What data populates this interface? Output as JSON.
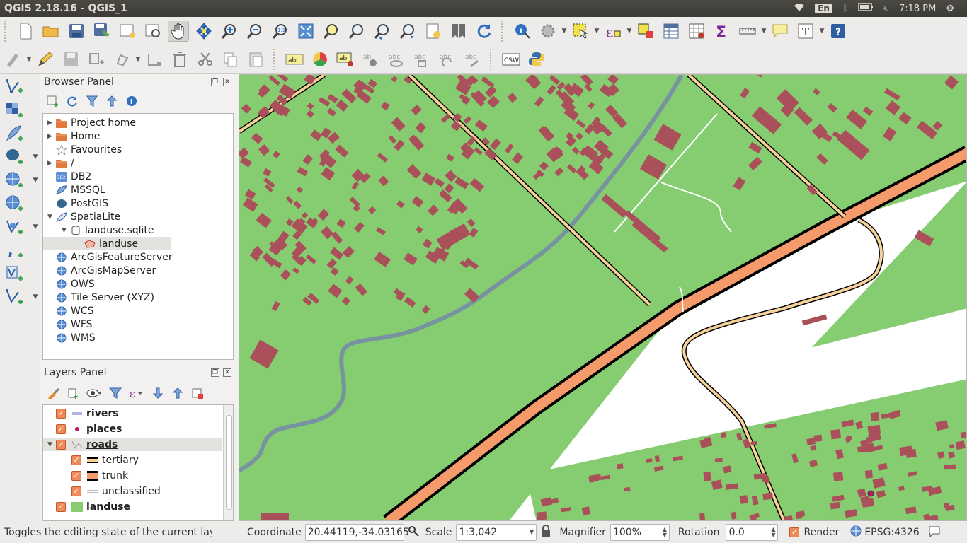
{
  "window": {
    "title": "QGIS 2.18.16 - QGIS_1"
  },
  "tray": {
    "lang": "En",
    "time": "7:18 PM"
  },
  "toolbar1": {
    "icons": [
      "new-project-icon",
      "open-project-icon",
      "save-project-icon",
      "save-as-icon",
      "new-print-composer-icon",
      "composer-manager-icon",
      "pan-icon",
      "pan-to-selection-icon",
      "zoom-in-icon",
      "zoom-out-icon",
      "zoom-native-icon",
      "zoom-full-icon",
      "zoom-to-selection-icon",
      "zoom-to-layer-icon",
      "zoom-last-icon",
      "zoom-next-icon",
      "new-bookmark-icon",
      "show-bookmarks-icon",
      "refresh-icon",
      "identify-icon",
      "run-feature-action-icon",
      "select-features-icon",
      "select-by-expression-icon",
      "deselect-icon",
      "attribute-table-icon",
      "field-calculator-icon",
      "statistics-icon",
      "measure-icon",
      "map-tips-icon",
      "text-annotation-icon",
      "help-icon"
    ]
  },
  "toolbar2": {
    "icons": [
      "current-edits-icon",
      "toggle-editing-icon",
      "save-edits-icon",
      "add-feature-icon",
      "move-feature-icon",
      "node-tool-icon",
      "delete-selected-icon",
      "cut-features-icon",
      "copy-features-icon",
      "paste-features-icon",
      "layer-labeling-icon",
      "diagram-options-icon",
      "pin-labels-icon",
      "show-hide-labels-icon",
      "move-label-icon",
      "rotate-label-icon",
      "change-label-icon",
      "csw-icon",
      "python-console-icon"
    ],
    "csw_label": "CSW",
    "abc_label": "abc"
  },
  "left_toolbar": {
    "icons": [
      "add-vector-layer-icon",
      "add-raster-layer-icon",
      "add-spatialite-layer-icon",
      "add-postgis-layer-icon",
      "add-wms-layer-icon",
      "add-wfs-layer-icon",
      "add-wcs-layer-icon",
      "add-delimited-text-icon",
      "add-virtual-layer-icon",
      "new-shapefile-icon"
    ]
  },
  "browser_panel": {
    "title": "Browser Panel",
    "items": [
      {
        "label": "Project home",
        "icon": "folder-icon",
        "arrow": "▶"
      },
      {
        "label": "Home",
        "icon": "folder-icon",
        "arrow": "▶"
      },
      {
        "label": "Favourites",
        "icon": "star-icon",
        "arrow": ""
      },
      {
        "label": "/",
        "icon": "folder-icon",
        "arrow": "▶"
      },
      {
        "label": "DB2",
        "icon": "db2-icon",
        "arrow": ""
      },
      {
        "label": "MSSQL",
        "icon": "mssql-icon",
        "arrow": ""
      },
      {
        "label": "PostGIS",
        "icon": "postgis-icon",
        "arrow": ""
      },
      {
        "label": "SpatiaLite",
        "icon": "spatialite-icon",
        "arrow": "▼"
      },
      {
        "label": "landuse.sqlite",
        "icon": "database-icon",
        "arrow": "▼"
      },
      {
        "label": "landuse",
        "icon": "polygon-layer-icon",
        "arrow": ""
      },
      {
        "label": "ArcGisFeatureServer",
        "icon": "globe-icon",
        "arrow": ""
      },
      {
        "label": "ArcGisMapServer",
        "icon": "globe-icon",
        "arrow": ""
      },
      {
        "label": "OWS",
        "icon": "globe-icon",
        "arrow": ""
      },
      {
        "label": "Tile Server (XYZ)",
        "icon": "globe-icon",
        "arrow": ""
      },
      {
        "label": "WCS",
        "icon": "globe-icon",
        "arrow": ""
      },
      {
        "label": "WFS",
        "icon": "globe-icon",
        "arrow": ""
      },
      {
        "label": "WMS",
        "icon": "globe-icon",
        "arrow": ""
      }
    ]
  },
  "layers_panel": {
    "title": "Layers Panel",
    "layers": [
      {
        "label": "rivers",
        "bold": true
      },
      {
        "label": "places",
        "bold": true
      },
      {
        "label": "roads",
        "bold": true
      },
      {
        "label": "tertiary",
        "bold": false
      },
      {
        "label": "trunk",
        "bold": false
      },
      {
        "label": "unclassified",
        "bold": false
      },
      {
        "label": "landuse",
        "bold": true
      }
    ]
  },
  "status": {
    "message": "Toggles the editing state of the current laye",
    "coordinate_label": "Coordinate",
    "coordinate_value": "20.44119,-34.03165",
    "scale_label": "Scale",
    "scale_value": "1:3,042",
    "magnifier_label": "Magnifier",
    "magnifier_value": "100%",
    "rotation_label": "Rotation",
    "rotation_value": "0.0",
    "render_label": "Render",
    "crs": "EPSG:4326"
  },
  "colors": {
    "landuse": "#86cd71",
    "building": "#a9505a",
    "river": "#7893a0",
    "trunk": "#f59a6a",
    "tertiary": "#f6d29a",
    "accent": "#f08a5a"
  }
}
